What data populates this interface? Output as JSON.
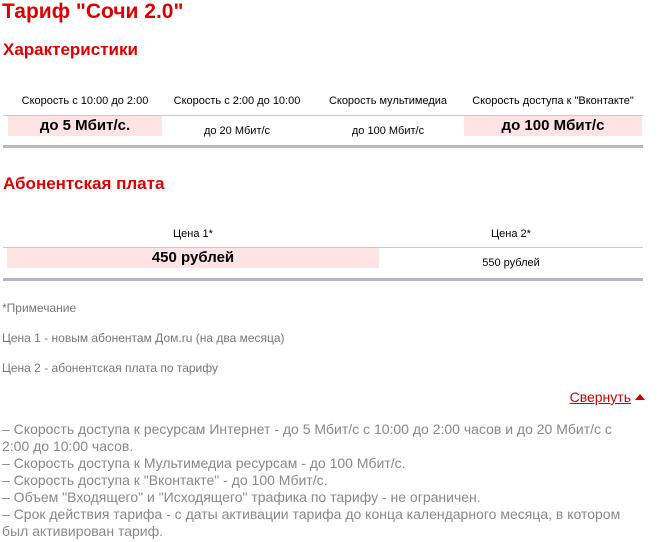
{
  "title": "Тариф \"Сочи 2.0\"",
  "sections": {
    "characteristics": {
      "heading": "Характеристики",
      "columns": [
        "Скорость с 10:00 до 2:00",
        "Скорость с 2:00 до 10:00",
        "Скорость мультимедиа",
        "Скорость доступа к \"Вконтакте\""
      ],
      "values": [
        "до 5 Мбит/с.",
        "до 20 Мбит/с",
        "до 100 Мбит/с",
        "до 100 Мбит/с"
      ]
    },
    "fee": {
      "heading": "Абонентская плата",
      "columns": [
        "Цена 1*",
        "Цена 2*"
      ],
      "values": [
        "450 рублей",
        "550 рублей"
      ]
    }
  },
  "notes": {
    "title": "*Примечание",
    "items": [
      "Цена 1 - новым абонентам Дом.ru (на два месяца)",
      "Цена 2 - абонентская плата по тарифу"
    ]
  },
  "collapse_link": "Свернуть",
  "details": [
    "– Скорость доступа к ресурсам Интернет - до 5 Мбит/с с 10:00 до 2:00 часов и до 20 Мбит/с с 2:00 до 10:00 часов.",
    "– Скорость доступа к Мультимедиа ресурсам - до 100 Мбит/с.",
    "– Скорость доступа к \"Вконтакте\" - до 100 Мбит/с.",
    "– Объем \"Входящего\" и \"Исходящего\" трафика по тарифу - не ограничен.",
    "– Срок действия тарифа - с даты активации тарифа до конца календарного месяца, в котором был активирован тариф."
  ],
  "colors": {
    "heading": "#dd0000",
    "highlight": "#fde3e3",
    "note_text": "#777777",
    "link": "#cc0000",
    "divider": "#b9b4c9"
  }
}
